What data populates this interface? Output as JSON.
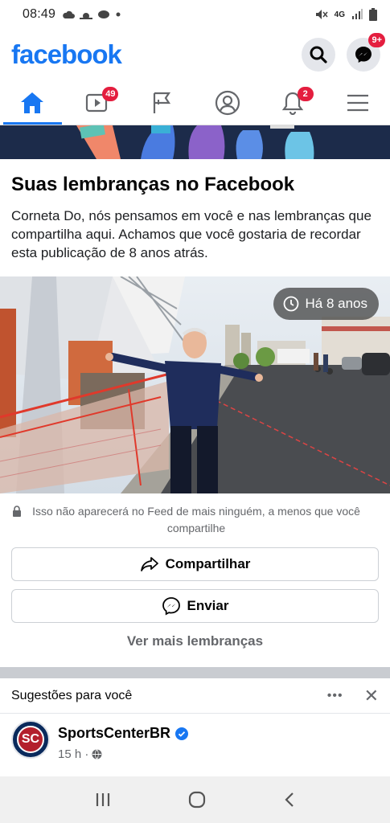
{
  "status": {
    "time": "08:49",
    "network": "4G"
  },
  "header": {
    "logo": "facebook",
    "messenger_badge": "9+"
  },
  "nav": {
    "video_badge": "49",
    "notifications_badge": "2"
  },
  "memories": {
    "title": "Suas lembranças no Facebook",
    "text": "Corneta Do, nós pensamos em você e nas lembranças que compartilha aqui. Achamos que você gostaria de recordar esta publicação de 8 anos atrás.",
    "time_ago": "Há 8 anos",
    "privacy_note": "Isso não aparecerá no Feed de mais ninguém, a menos que você compartilhe",
    "share_label": "Compartilhar",
    "send_label": "Enviar",
    "more_label": "Ver mais lembranças"
  },
  "suggestions": {
    "title": "Sugestões para você",
    "more": "•••",
    "close": "✕"
  },
  "post": {
    "page_name": "SportsCenterBR",
    "avatar_text": "SC",
    "time": "15 h ·"
  },
  "colors": {
    "brand": "#1877f2",
    "badge": "#e41e3f"
  }
}
